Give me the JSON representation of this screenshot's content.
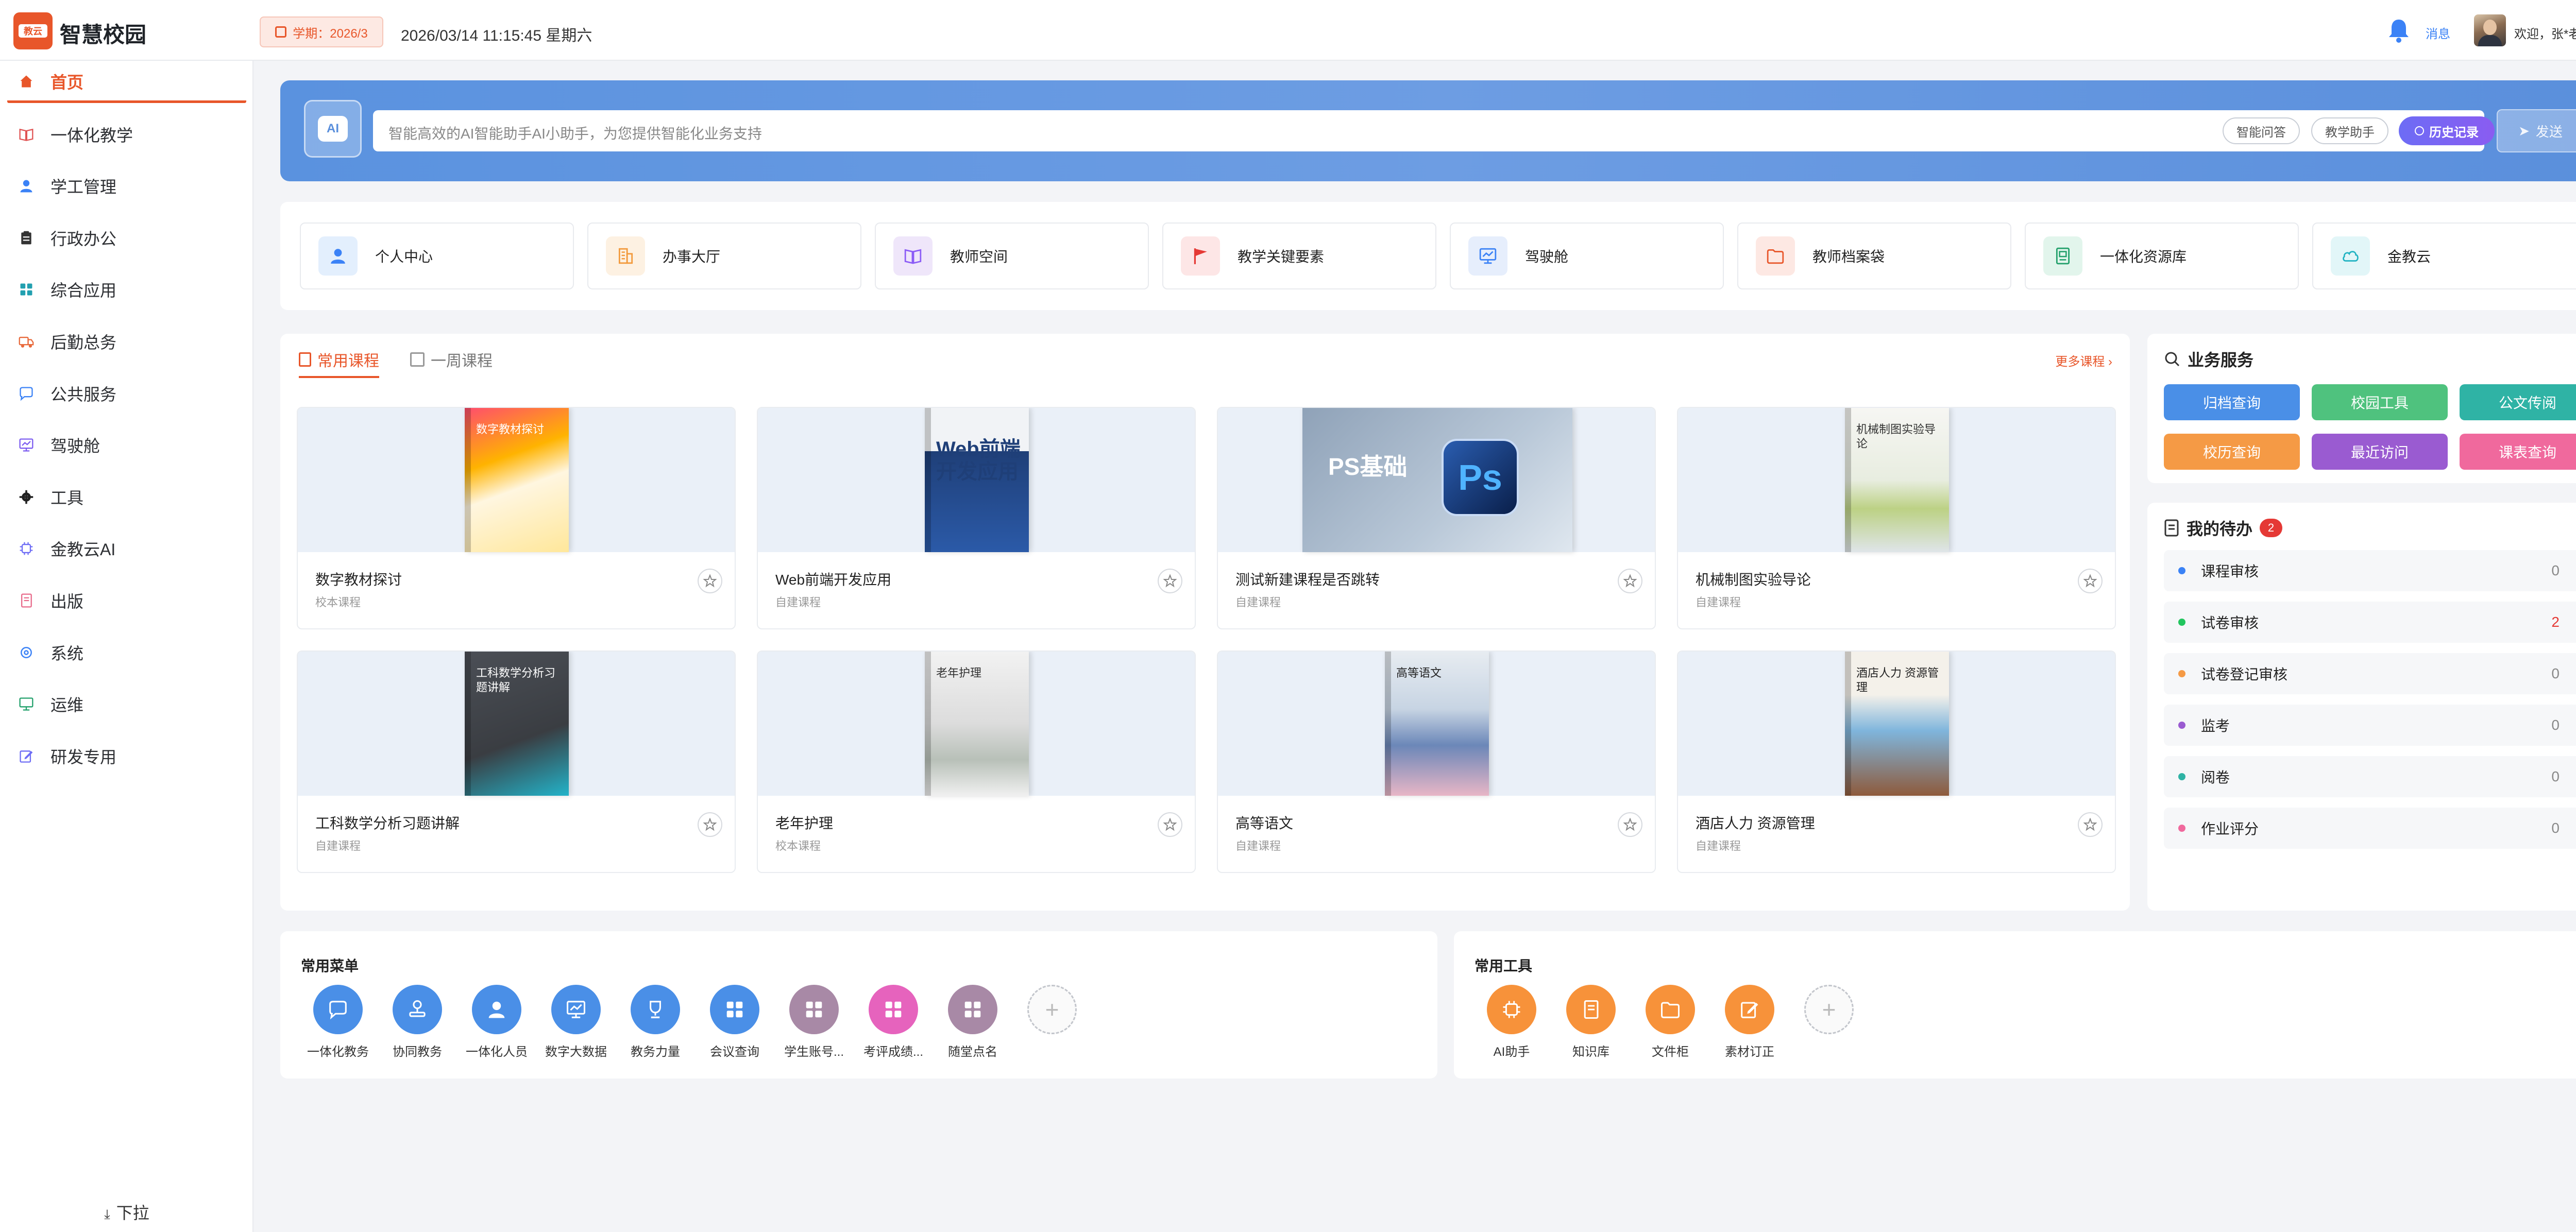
{
  "app": {
    "logo_text": "教云",
    "title": "智慧校园",
    "term_label": "学期：2026/3",
    "datetime": "2026/03/14 11:15:45 星期六",
    "messages_label": "消息",
    "welcome": "欢迎，张*老师"
  },
  "colors": {
    "brand": "#e8562a",
    "primary_blue": "#3b82f6"
  },
  "sidebar": {
    "items": [
      {
        "label": "首页",
        "icon": "home-icon",
        "active": true
      },
      {
        "label": "一体化教学",
        "icon": "book-open-icon"
      },
      {
        "label": "学工管理",
        "icon": "user-icon"
      },
      {
        "label": "行政办公",
        "icon": "clipboard-icon"
      },
      {
        "label": "综合应用",
        "icon": "grid-icon"
      },
      {
        "label": "后勤总务",
        "icon": "truck-icon"
      },
      {
        "label": "公共服务",
        "icon": "chat-icon"
      },
      {
        "label": "驾驶舱",
        "icon": "dashboard-icon"
      },
      {
        "label": "工具",
        "icon": "gear-icon"
      },
      {
        "label": "金教云AI",
        "icon": "chip-icon"
      },
      {
        "label": "出版",
        "icon": "book-icon"
      },
      {
        "label": "系统",
        "icon": "settings-icon"
      },
      {
        "label": "运维",
        "icon": "monitor-icon"
      },
      {
        "label": "研发专用",
        "icon": "edit-icon"
      }
    ],
    "pull_label": "下拉"
  },
  "ai_bar": {
    "placeholder": "智能高效的AI智能助手AI小助手，为您提供智能化业务支持",
    "chip_qa": "智能问答",
    "chip_teaching": "教学助手",
    "history": "历史记录",
    "send": "发送"
  },
  "quick_links": [
    {
      "label": "个人中心",
      "icon": "user-icon",
      "bg": "#e3effd",
      "fg": "#3b82f6"
    },
    {
      "label": "办事大厅",
      "icon": "building-icon",
      "bg": "#fdf1e2",
      "fg": "#f29a3c"
    },
    {
      "label": "教师空间",
      "icon": "book-open-icon",
      "bg": "#efe6fa",
      "fg": "#8b5cf6"
    },
    {
      "label": "教学关键要素",
      "icon": "flag-icon",
      "bg": "#fde6e6",
      "fg": "#e53935"
    },
    {
      "label": "驾驶舱",
      "icon": "dashboard-icon",
      "bg": "#e6eefc",
      "fg": "#3b82f6"
    },
    {
      "label": "教师档案袋",
      "icon": "folder-icon",
      "bg": "#fde8e3",
      "fg": "#e8562a"
    },
    {
      "label": "一体化资源库",
      "icon": "archive-icon",
      "bg": "#e2f5ec",
      "fg": "#22a06b"
    },
    {
      "label": "金教云",
      "icon": "cloud-icon",
      "bg": "#e2f6f8",
      "fg": "#22b3c2"
    }
  ],
  "courses": {
    "tab_common": "常用课程",
    "tab_week": "一周课程",
    "more": "更多课程",
    "items": [
      {
        "name": "数字教材探讨",
        "type": "校本课程",
        "cover_title": "数字教材探讨",
        "style": "c1"
      },
      {
        "name": "Web前端开发应用",
        "type": "自建课程",
        "cover_title": "Web前端开发应用",
        "style": "c2"
      },
      {
        "name": "测试新建课程是否跳转",
        "type": "自建课程",
        "cover_title": "PS基础",
        "style": "c3"
      },
      {
        "name": "机械制图实验导论",
        "type": "自建课程",
        "cover_title": "机械制图实验导论",
        "style": "c4"
      },
      {
        "name": "工科数学分析习题讲解",
        "type": "自建课程",
        "cover_title": "工科数学分析习题讲解",
        "style": "c5"
      },
      {
        "name": "老年护理",
        "type": "校本课程",
        "cover_title": "老年护理",
        "style": "c6"
      },
      {
        "name": "高等语文",
        "type": "自建课程",
        "cover_title": "高等语文",
        "style": "c7"
      },
      {
        "name": "酒店人力 资源管理",
        "type": "自建课程",
        "cover_title": "酒店人力 资源管理",
        "style": "c8"
      }
    ]
  },
  "services": {
    "title": "业务服务",
    "buttons": [
      {
        "label": "归档查询",
        "color": "#4a8fe7"
      },
      {
        "label": "校园工具",
        "color": "#4fc27e"
      },
      {
        "label": "公文传阅",
        "color": "#2fb3a5"
      },
      {
        "label": "校历查询",
        "color": "#f59a45"
      },
      {
        "label": "最近访问",
        "color": "#9a5bd1"
      },
      {
        "label": "课表查询",
        "color": "#f0699d"
      }
    ]
  },
  "todos": {
    "title": "我的待办",
    "count": "2",
    "items": [
      {
        "label": "课程审核",
        "count": "0",
        "color": "#3b82f6"
      },
      {
        "label": "试卷审核",
        "count": "2",
        "color": "#22c55e",
        "highlight": true
      },
      {
        "label": "试卷登记审核",
        "count": "0",
        "color": "#f59a45"
      },
      {
        "label": "监考",
        "count": "0",
        "color": "#9a5bd1"
      },
      {
        "label": "阅卷",
        "count": "0",
        "color": "#2fb3a5"
      },
      {
        "label": "作业评分",
        "count": "0",
        "color": "#f0699d"
      }
    ]
  },
  "common_menu": {
    "title": "常用菜单",
    "items": [
      {
        "label": "一体化教务",
        "color": "#4a8fe7",
        "icon": "chat-icon"
      },
      {
        "label": "协同教务",
        "color": "#4a8fe7",
        "icon": "stamp-icon"
      },
      {
        "label": "一体化人员",
        "color": "#4a8fe7",
        "icon": "user-icon"
      },
      {
        "label": "数字大数据",
        "color": "#4a8fe7",
        "icon": "dashboard-icon"
      },
      {
        "label": "教务力量",
        "color": "#4a8fe7",
        "icon": "trophy-icon"
      },
      {
        "label": "会议查询",
        "color": "#4a8fe7",
        "icon": "grid-icon"
      },
      {
        "label": "学生账号...",
        "color": "#a889a6",
        "icon": "grid-icon"
      },
      {
        "label": "考评成绩...",
        "color": "#e663bd",
        "icon": "grid-icon"
      },
      {
        "label": "随堂点名",
        "color": "#a889a6",
        "icon": "grid-icon"
      }
    ]
  },
  "common_tools": {
    "title": "常用工具",
    "items": [
      {
        "label": "AI助手",
        "color": "#f7923a",
        "icon": "chip-icon"
      },
      {
        "label": "知识库",
        "color": "#f7923a",
        "icon": "book-icon"
      },
      {
        "label": "文件柜",
        "color": "#f7923a",
        "icon": "folder-icon"
      },
      {
        "label": "素材订正",
        "color": "#f7923a",
        "icon": "edit-icon"
      }
    ]
  }
}
